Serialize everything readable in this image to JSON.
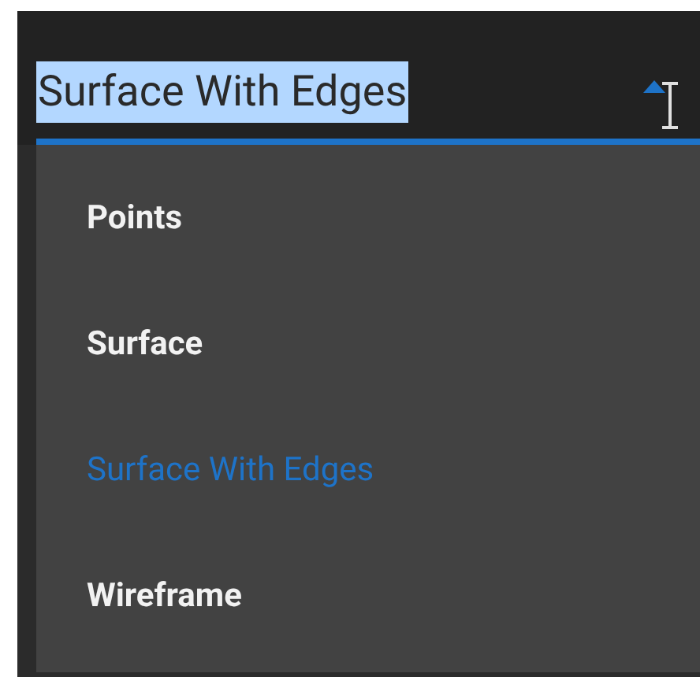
{
  "combo_box": {
    "value": "Surface With Edges",
    "highlighted": true,
    "expanded": true
  },
  "options": [
    {
      "label": "Points",
      "selected": false
    },
    {
      "label": "Surface",
      "selected": false
    },
    {
      "label": "Surface With Edges",
      "selected": true
    },
    {
      "label": "Wireframe",
      "selected": false
    }
  ]
}
